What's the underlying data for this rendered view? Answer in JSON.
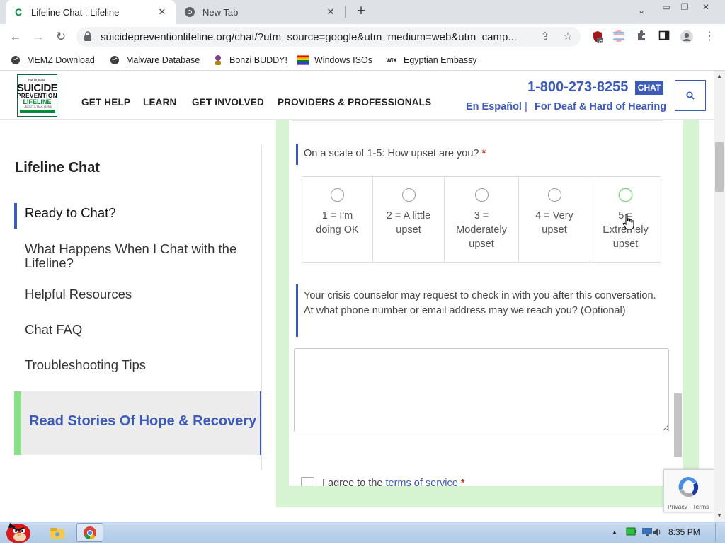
{
  "browser": {
    "tabs": [
      {
        "title": "Lifeline Chat : Lifeline",
        "active": true,
        "favicon": "lifeline-c-icon"
      },
      {
        "title": "New Tab",
        "active": false,
        "favicon": "chrome-icon"
      }
    ],
    "url": "suicidepreventionlifeline.org/chat/?utm_source=google&utm_medium=web&utm_camp...",
    "extension_badge": "6",
    "bookmarks": [
      {
        "label": "MEMZ Download",
        "icon": "globe-icon"
      },
      {
        "label": "Malware Database",
        "icon": "globe-icon"
      },
      {
        "label": "Bonzi BUDDY!",
        "icon": "bonzi-icon"
      },
      {
        "label": "Windows ISOs",
        "icon": "rainbow-flag-icon"
      },
      {
        "label": "Egyptian Embassy",
        "icon": "wix-icon"
      }
    ],
    "wix_text": "WIX"
  },
  "site": {
    "logo": {
      "line1": "NATIONAL",
      "line2": "SUICIDE",
      "line3": "PREVENTION",
      "line4": "LIFELINE",
      "line5": "1-800-273-TALK (8255)"
    },
    "nav": [
      "GET HELP",
      "LEARN",
      "GET INVOLVED",
      "PROVIDERS & PROFESSIONALS"
    ],
    "phone": "1-800-273-8255",
    "chat_badge": "CHAT",
    "espanol": "En Español",
    "pipe": "|",
    "deaf": "For Deaf & Hard of Hearing"
  },
  "sidebar": {
    "title": "Lifeline Chat",
    "items": [
      {
        "label": "Ready to Chat?",
        "active": true
      },
      {
        "label": "What Happens When I Chat with the Lifeline?"
      },
      {
        "label": "Helpful Resources"
      },
      {
        "label": "Chat FAQ"
      },
      {
        "label": "Troubleshooting Tips"
      }
    ],
    "stories": "Read Stories Of Hope & Recovery"
  },
  "form": {
    "q1": "On a scale of 1-5: How upset are you?",
    "required_mark": "*",
    "options": [
      "1 = I'm doing OK",
      "2 = A little upset",
      "3 = Moderately upset",
      "4 = Very upset",
      "5 = Extremely upset"
    ],
    "q2": "Your crisis counselor may request to check in with you after this conversation. At what phone number or email address may we reach you? (Optional)",
    "contact_value": "",
    "agree_prefix": "I agree to the ",
    "agree_link": "terms of service",
    "agree_suffix": " *"
  },
  "recaptcha": {
    "text": "Privacy - Terms"
  },
  "taskbar": {
    "time": "8:35 PM"
  },
  "colors": {
    "brand_blue": "#3d5bb6",
    "panel_green": "#d6f3d2",
    "accent_green": "#8de08a"
  }
}
